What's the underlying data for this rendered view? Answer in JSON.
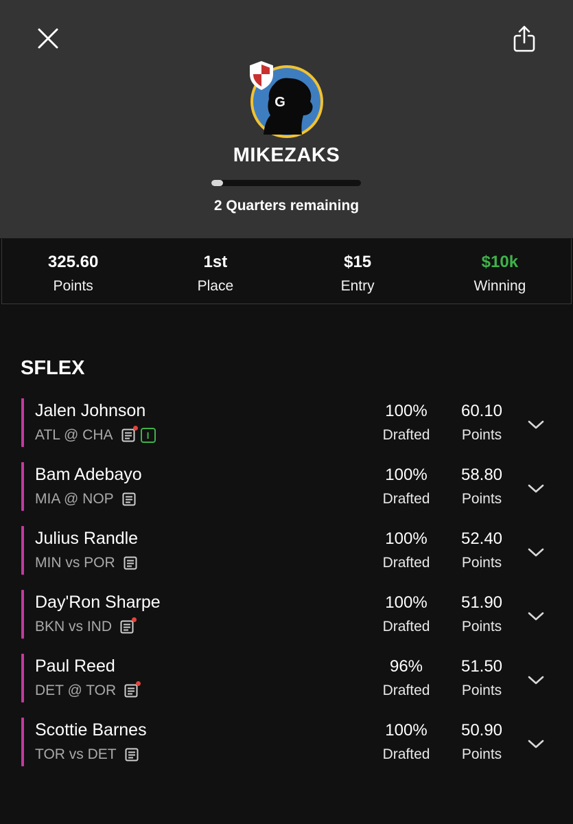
{
  "header": {
    "username": "MIKEZAKS",
    "avatar_letter": "G",
    "progress_fraction": 0.08,
    "remaining_text": "2 Quarters remaining"
  },
  "stats": [
    {
      "value": "325.60",
      "label": "Points"
    },
    {
      "value": "1st",
      "label": "Place"
    },
    {
      "value": "$15",
      "label": "Entry"
    },
    {
      "value": "$10k",
      "label": "Winning",
      "accent": "#3fb24a"
    }
  ],
  "section": {
    "title": "SFLEX"
  },
  "players": [
    {
      "name": "Jalen Johnson",
      "game": "ATL @ CHA",
      "news_alert": true,
      "status_badge": "I",
      "drafted": "100%",
      "drafted_label": "Drafted",
      "points": "60.10",
      "points_label": "Points"
    },
    {
      "name": "Bam Adebayo",
      "game": "MIA @ NOP",
      "news_alert": false,
      "status_badge": "",
      "drafted": "100%",
      "drafted_label": "Drafted",
      "points": "58.80",
      "points_label": "Points"
    },
    {
      "name": "Julius Randle",
      "game": "MIN vs POR",
      "news_alert": false,
      "status_badge": "",
      "drafted": "100%",
      "drafted_label": "Drafted",
      "points": "52.40",
      "points_label": "Points"
    },
    {
      "name": "Day'Ron Sharpe",
      "game": "BKN vs IND",
      "news_alert": true,
      "status_badge": "",
      "drafted": "100%",
      "drafted_label": "Drafted",
      "points": "51.90",
      "points_label": "Points"
    },
    {
      "name": "Paul Reed",
      "game": "DET @ TOR",
      "news_alert": true,
      "status_badge": "",
      "drafted": "96%",
      "drafted_label": "Drafted",
      "points": "51.50",
      "points_label": "Points"
    },
    {
      "name": "Scottie Barnes",
      "game": "TOR vs DET",
      "news_alert": false,
      "status_badge": "",
      "drafted": "100%",
      "drafted_label": "Drafted",
      "points": "50.90",
      "points_label": "Points"
    }
  ],
  "colors": {
    "accent_bar": "#c13aa0",
    "winning": "#3fb24a",
    "alert_dot": "#e5433b",
    "header_bg": "#343434",
    "page_bg": "#111111"
  },
  "icons": {
    "close": "close-icon",
    "share": "share-icon",
    "news": "news-icon",
    "expand": "chevron-down-icon"
  }
}
